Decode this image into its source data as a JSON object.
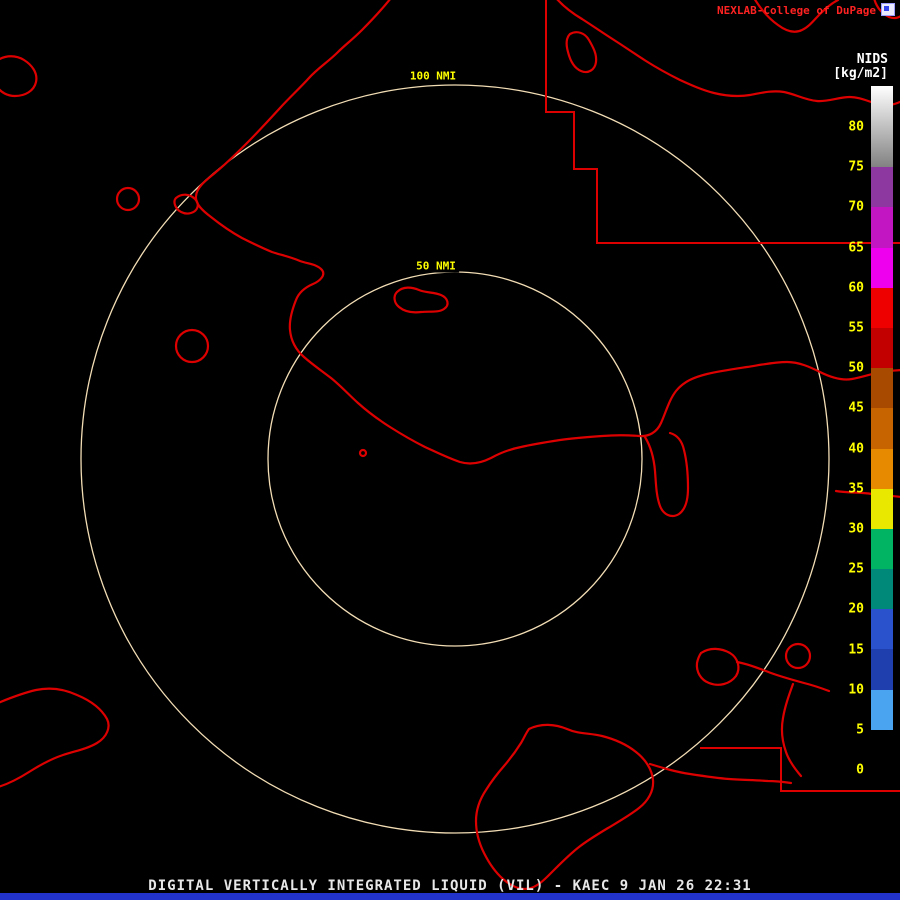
{
  "header": {
    "brand": "NEXLAB-College of DuPage",
    "brand_color": "#ff2222"
  },
  "scale": {
    "title": "NIDS",
    "units": "[kg/m2]",
    "label_color": "#ffff00",
    "ticks": [
      "80",
      "75",
      "70",
      "65",
      "60",
      "55",
      "50",
      "45",
      "40",
      "35",
      "30",
      "25",
      "20",
      "15",
      "10",
      "5",
      "0"
    ],
    "segments": [
      {
        "range": "75-80+",
        "color": "#ffffff,#828282"
      },
      {
        "range": "70-75",
        "color": "#8c38a0"
      },
      {
        "range": "65-70",
        "color": "#c316c3"
      },
      {
        "range": "60-65",
        "color": "#ee00ee"
      },
      {
        "range": "55-60",
        "color": "#ee0000"
      },
      {
        "range": "50-55",
        "color": "#c30000"
      },
      {
        "range": "45-50",
        "color": "#a84b00"
      },
      {
        "range": "40-45",
        "color": "#c86400"
      },
      {
        "range": "35-40",
        "color": "#e88a00"
      },
      {
        "range": "30-35",
        "color": "#e8e800"
      },
      {
        "range": "25-30",
        "color": "#00b464"
      },
      {
        "range": "20-25",
        "color": "#008878"
      },
      {
        "range": "15-20",
        "color": "#2a52cc"
      },
      {
        "range": "10-15",
        "color": "#1f3fae"
      },
      {
        "range": "5-10",
        "color": "#4aa4f0"
      },
      {
        "range": "0-5",
        "color": "#000000"
      }
    ]
  },
  "rings": {
    "outer_label": "100 NMI",
    "inner_label": "50 NMI",
    "color": "#f2ddb5",
    "label_color": "#ffff00"
  },
  "map": {
    "line_color": "#dd0000"
  },
  "footer": {
    "title": "DIGITAL VERTICALLY INTEGRATED LIQUID (VIL) - KAEC 9 JAN 26 22:31",
    "color": "#e8e8e8",
    "bar_color": "#2233cc"
  }
}
